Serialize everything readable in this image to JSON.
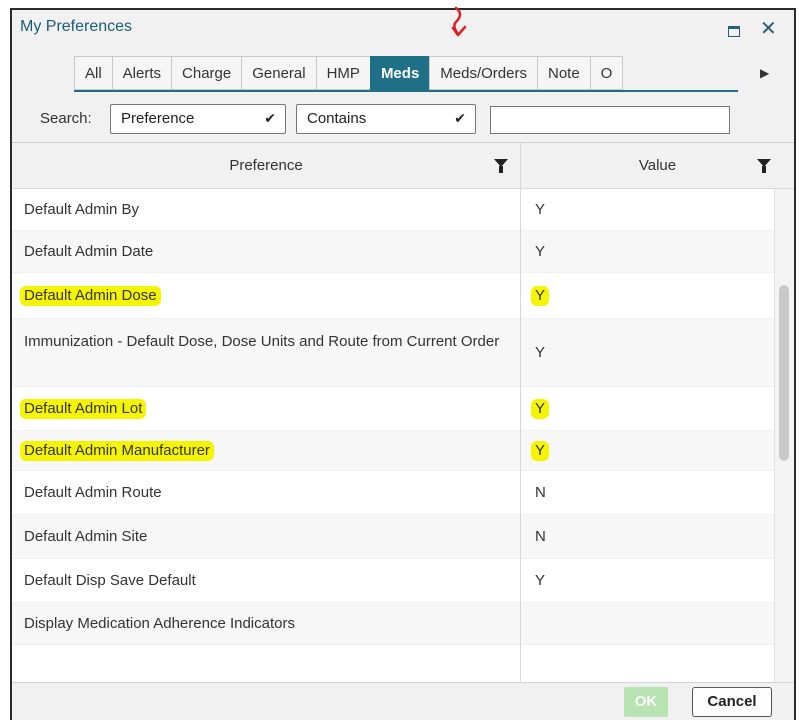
{
  "window": {
    "title": "My Preferences"
  },
  "tabs": [
    {
      "label": "All",
      "active": false
    },
    {
      "label": "Alerts",
      "active": false
    },
    {
      "label": "Charge",
      "active": false
    },
    {
      "label": "General",
      "active": false
    },
    {
      "label": "HMP",
      "active": false
    },
    {
      "label": "Meds",
      "active": true
    },
    {
      "label": "Meds/Orders",
      "active": false
    },
    {
      "label": "Note",
      "active": false
    },
    {
      "label": "O",
      "active": false
    }
  ],
  "search": {
    "label": "Search:",
    "field_select": "Preference",
    "operator_select": "Contains",
    "value": ""
  },
  "grid": {
    "columns": [
      "Preference",
      "Value"
    ],
    "rows": [
      {
        "preference": "Default Admin By",
        "value": "Y",
        "highlighted": false
      },
      {
        "preference": "Default Admin Date",
        "value": "Y",
        "highlighted": false
      },
      {
        "preference": "Default Admin Dose",
        "value": "Y",
        "highlighted": true
      },
      {
        "preference": "Immunization - Default Dose, Dose Units and Route from Current Order",
        "value": "Y",
        "highlighted": false
      },
      {
        "preference": "Default Admin Lot",
        "value": "Y",
        "highlighted": true
      },
      {
        "preference": "Default Admin Manufacturer",
        "value": "Y",
        "highlighted": true
      },
      {
        "preference": "Default Admin Route",
        "value": "N",
        "highlighted": false
      },
      {
        "preference": "Default Admin Site",
        "value": "N",
        "highlighted": false
      },
      {
        "preference": "Default Disp Save Default",
        "value": "Y",
        "highlighted": false
      },
      {
        "preference": "Display Medication Adherence Indicators",
        "value": "",
        "highlighted": false
      }
    ]
  },
  "footer": {
    "ok_label": "OK",
    "cancel_label": "Cancel"
  },
  "colors": {
    "accent": "#1f6f86",
    "highlight": "#f5f500",
    "annotation": "#e02020"
  }
}
